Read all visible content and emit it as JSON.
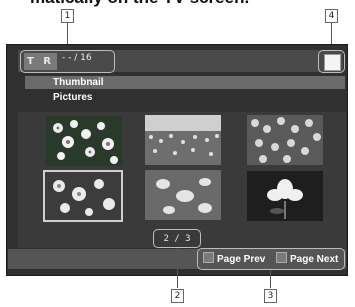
{
  "heading": "matically on the TV screen.",
  "callouts": [
    "1",
    "2",
    "3",
    "4"
  ],
  "badge": "T R",
  "track_count": "- - / 16",
  "titles": [
    "Thumbnail",
    "Pictures"
  ],
  "page_indicator": "2  /  3",
  "buttons": {
    "prev": "Page Prev",
    "next": "Page Next"
  },
  "thumbnails": [
    "flowers",
    "flower-field",
    "blossoms",
    "flowers-selected",
    "petals",
    "white-flower"
  ]
}
